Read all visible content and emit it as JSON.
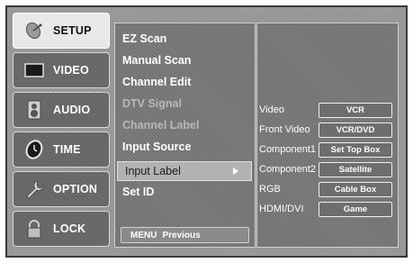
{
  "tabs": [
    {
      "label": "SETUP",
      "icon": "satellite-dish-icon",
      "active": true
    },
    {
      "label": "VIDEO",
      "icon": "tv-screen-icon",
      "active": false
    },
    {
      "label": "AUDIO",
      "icon": "speaker-icon",
      "active": false
    },
    {
      "label": "TIME",
      "icon": "clock-icon",
      "active": false
    },
    {
      "label": "OPTION",
      "icon": "wrench-icon",
      "active": false
    },
    {
      "label": "LOCK",
      "icon": "padlock-icon",
      "active": false
    }
  ],
  "menu": {
    "items": [
      {
        "label": "EZ Scan",
        "dim": false
      },
      {
        "label": "Manual Scan",
        "dim": false
      },
      {
        "label": "Channel Edit",
        "dim": false
      },
      {
        "label": "DTV Signal",
        "dim": true
      },
      {
        "label": "Channel Label",
        "dim": true
      },
      {
        "label": "Input Source",
        "dim": false
      },
      {
        "label": "Input Label",
        "selected": true
      },
      {
        "label": "Set ID",
        "dim": false
      }
    ],
    "footer_key": "MENU",
    "footer_action": "Previous"
  },
  "input_labels": {
    "rows": [
      {
        "source": "Video",
        "label": "VCR"
      },
      {
        "source": "Front Video",
        "label": "VCR/DVD"
      },
      {
        "source": "Component1",
        "label": "Set Top Box"
      },
      {
        "source": "Component2",
        "label": "Satellite"
      },
      {
        "source": "RGB",
        "label": "Cable Box"
      },
      {
        "source": "HDMI/DVI",
        "label": "Game"
      }
    ]
  }
}
